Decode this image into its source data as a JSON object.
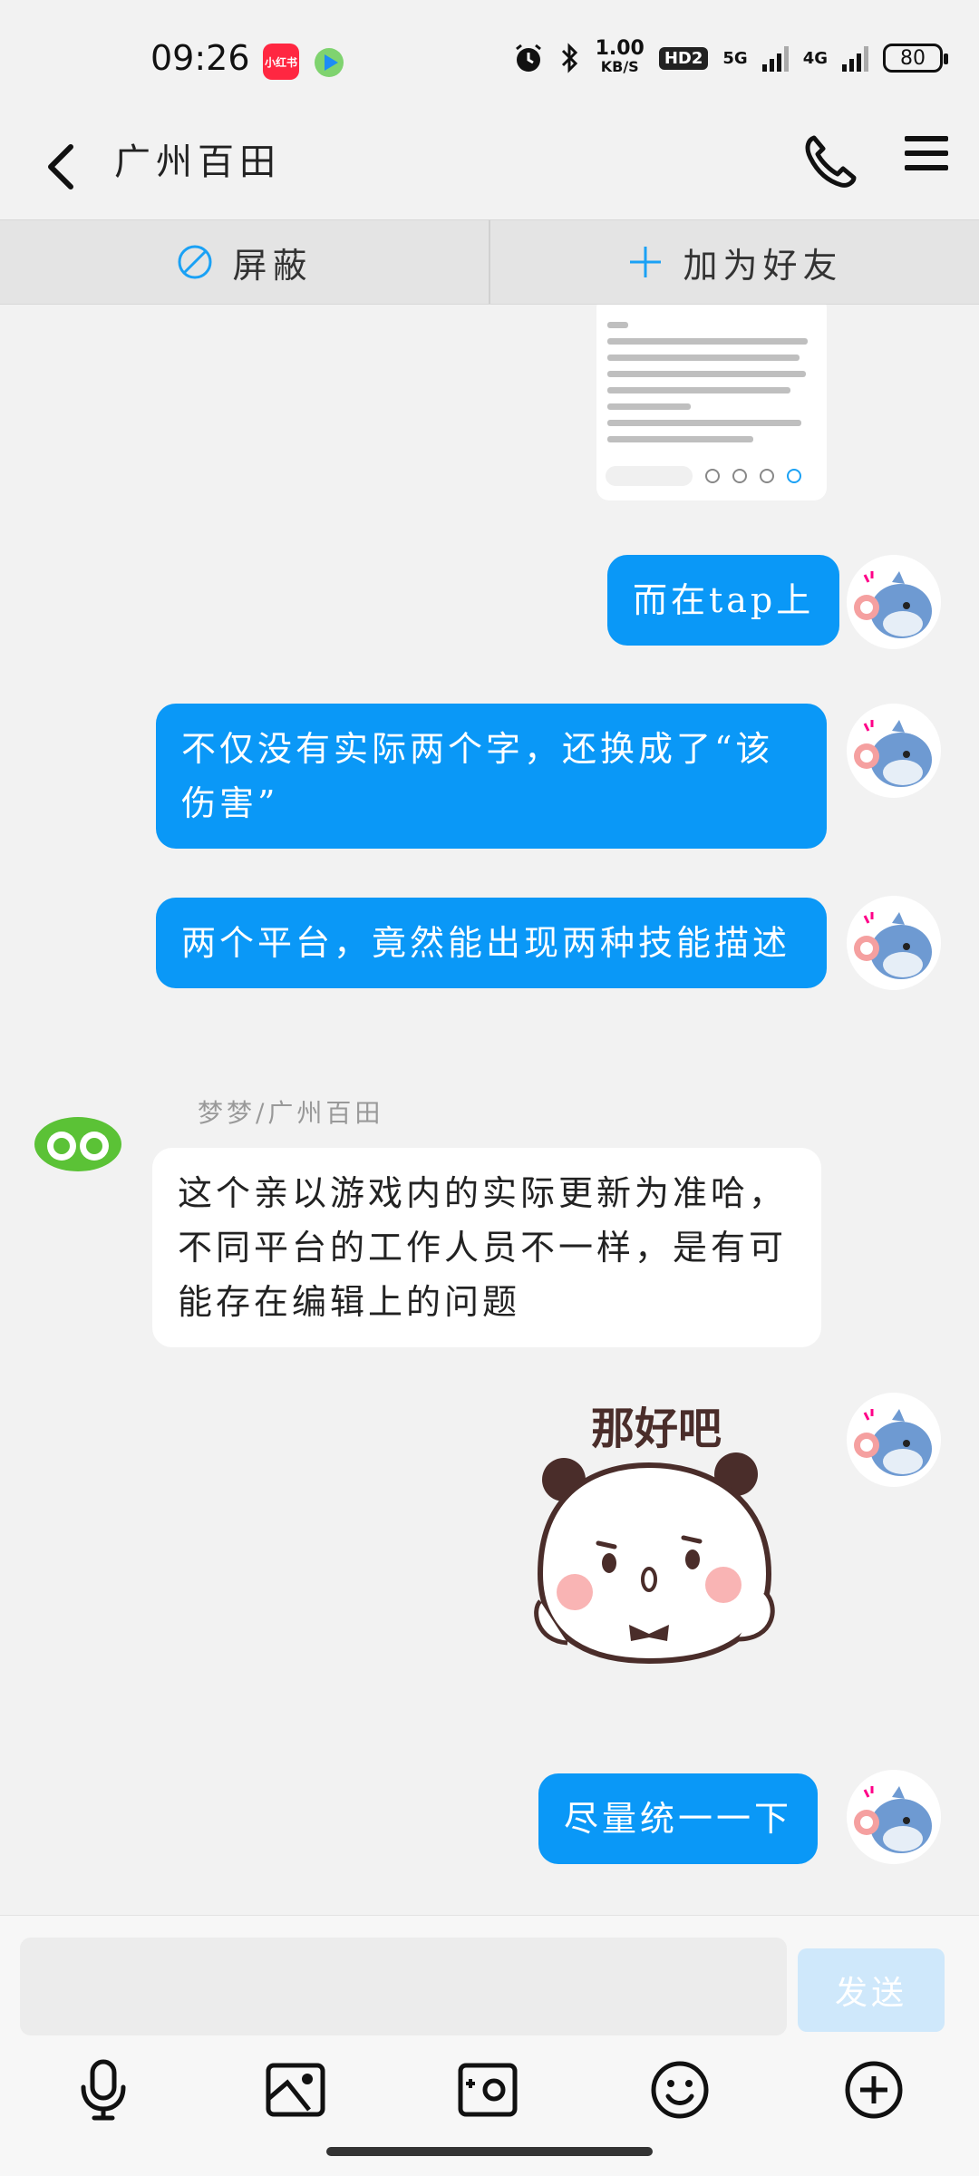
{
  "status_bar": {
    "time": "09:26",
    "app_badge": "小红书",
    "net_speed_value": "1.00",
    "net_speed_unit": "KB/S",
    "hd": "HD2",
    "sim1": "5G",
    "sim2": "4G",
    "battery": "80"
  },
  "header": {
    "title": "广州百田"
  },
  "action_bar": {
    "block_label": "屏蔽",
    "add_friend_label": "加为好友"
  },
  "messages": [
    {
      "from": "me",
      "type": "image",
      "desc": ""
    },
    {
      "from": "me",
      "text": "而在tap上"
    },
    {
      "from": "me",
      "text": "不仅没有实际两个字，还换成了“该伤害”"
    },
    {
      "from": "me",
      "text": "两个平台，竟然能出现两种技能描述"
    },
    {
      "from": "other",
      "nick": "梦梦/广州百田",
      "text": "这个亲以游戏内的实际更新为准哈，不同平台的工作人员不一样，是有可能存在编辑上的问题"
    },
    {
      "from": "me",
      "type": "sticker",
      "text": "那好吧"
    },
    {
      "from": "me",
      "text": "尽量统一一下"
    }
  ],
  "input": {
    "placeholder": "",
    "send_label": "发送"
  },
  "colors": {
    "bubble_blue": "#0a98f7",
    "background": "#f2f2f2",
    "accent": "#1aa1f5"
  }
}
